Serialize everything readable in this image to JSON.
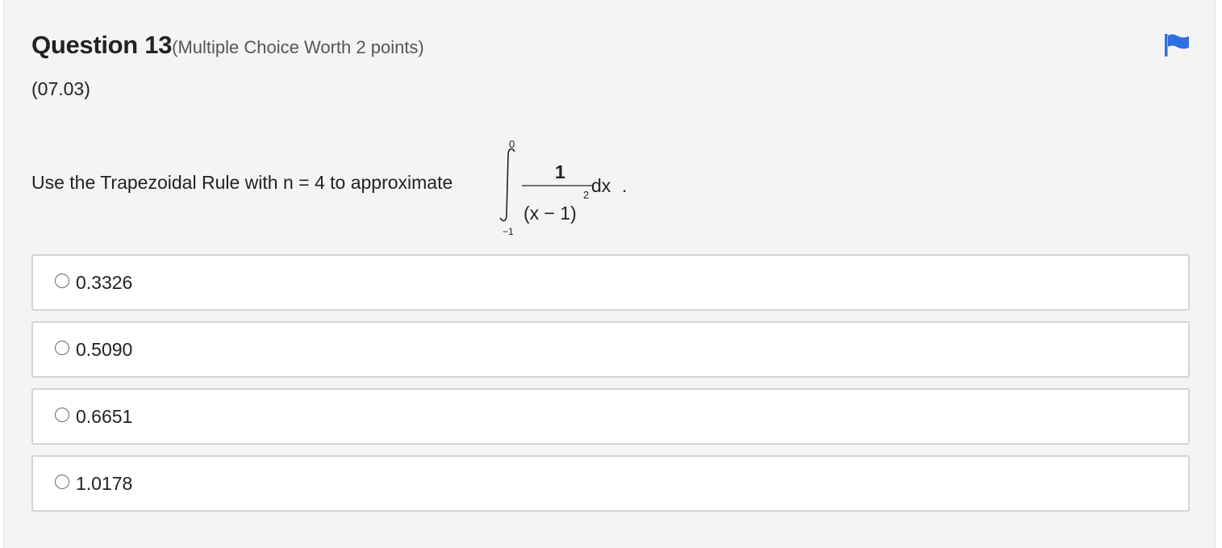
{
  "question": {
    "title": "Question 13",
    "meta": "(Multiple Choice Worth 2 points)",
    "code": "(07.03)",
    "prompt": "Use the Trapezoidal Rule with n = 4 to approximate",
    "integral": {
      "upper_limit": "0",
      "lower_limit": "−1",
      "numerator": "1",
      "denominator": "(x − 1)",
      "exponent": "2",
      "differential": "dx",
      "end_punct": "."
    }
  },
  "flag": {
    "icon": "flag-icon",
    "color": "#2f6fe0"
  },
  "options": [
    {
      "label": "0.3326",
      "selected": false
    },
    {
      "label": "0.5090",
      "selected": false
    },
    {
      "label": "0.6651",
      "selected": false
    },
    {
      "label": "1.0178",
      "selected": false
    }
  ]
}
